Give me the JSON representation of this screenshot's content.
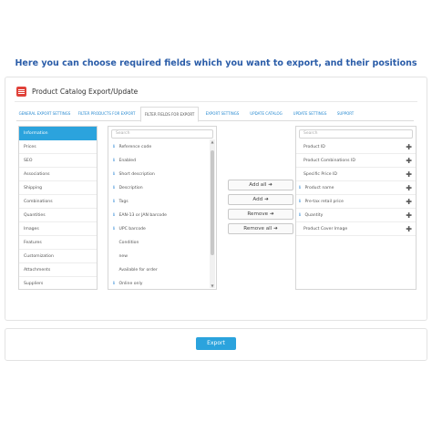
{
  "headline": "Here you can choose required fields which you want to export, and their positions",
  "panel": {
    "title": "Product Catalog Export/Update",
    "icon": "catalog-icon",
    "accent": "#e0423a"
  },
  "tabs": [
    {
      "label": "GENERAL EXPORT SETTINGS"
    },
    {
      "label": "FILTER PRODUCTS FOR EXPORT"
    },
    {
      "label": "FILTER FIELDS FOR EXPORT"
    },
    {
      "label": "EXPORT SETTINGS"
    },
    {
      "label": "UPDATE CATALOG"
    },
    {
      "label": "UPDATE SETTINGS"
    },
    {
      "label": "SUPPORT"
    }
  ],
  "active_tab": "FILTER FIELDS FOR EXPORT",
  "categories": [
    {
      "label": "Information"
    },
    {
      "label": "Prices"
    },
    {
      "label": "SEO"
    },
    {
      "label": "Associations"
    },
    {
      "label": "Shipping"
    },
    {
      "label": "Combinations"
    },
    {
      "label": "Quantities"
    },
    {
      "label": "Images"
    },
    {
      "label": "Features"
    },
    {
      "label": "Customization"
    },
    {
      "label": "Attachments"
    },
    {
      "label": "Suppliers"
    }
  ],
  "available": {
    "search_placeholder": "Search",
    "fields": [
      {
        "label": "Reference code",
        "info": true
      },
      {
        "label": "Enabled",
        "info": true
      },
      {
        "label": "Short description",
        "info": true
      },
      {
        "label": "Description",
        "info": true
      },
      {
        "label": "Tags",
        "info": true
      },
      {
        "label": "EAN-13 or JAN barcode",
        "info": true
      },
      {
        "label": "UPC barcode",
        "info": true
      },
      {
        "label": "Condition",
        "info": false
      },
      {
        "label": "new",
        "info": false
      },
      {
        "label": "Available for order",
        "info": false
      },
      {
        "label": "Online only",
        "info": true
      }
    ]
  },
  "buttons": {
    "add_all": "Add all ➜",
    "add": "Add ➜",
    "remove": "Remove ➜",
    "remove_all": "Remove all ➜"
  },
  "selected": {
    "search_placeholder": "Search",
    "fields": [
      {
        "label": "Product ID",
        "info": false
      },
      {
        "label": "Product Combinations ID",
        "info": false
      },
      {
        "label": "Specific Price ID",
        "info": false
      },
      {
        "label": "Product name",
        "info": true
      },
      {
        "label": "Pre-tax retail price",
        "info": true
      },
      {
        "label": "Quantity",
        "info": true
      },
      {
        "label": "Product Cover Image",
        "info": false
      }
    ]
  },
  "export_label": "Export",
  "colors": {
    "primary": "#2ba3dd",
    "headline": "#2a5ca8"
  }
}
